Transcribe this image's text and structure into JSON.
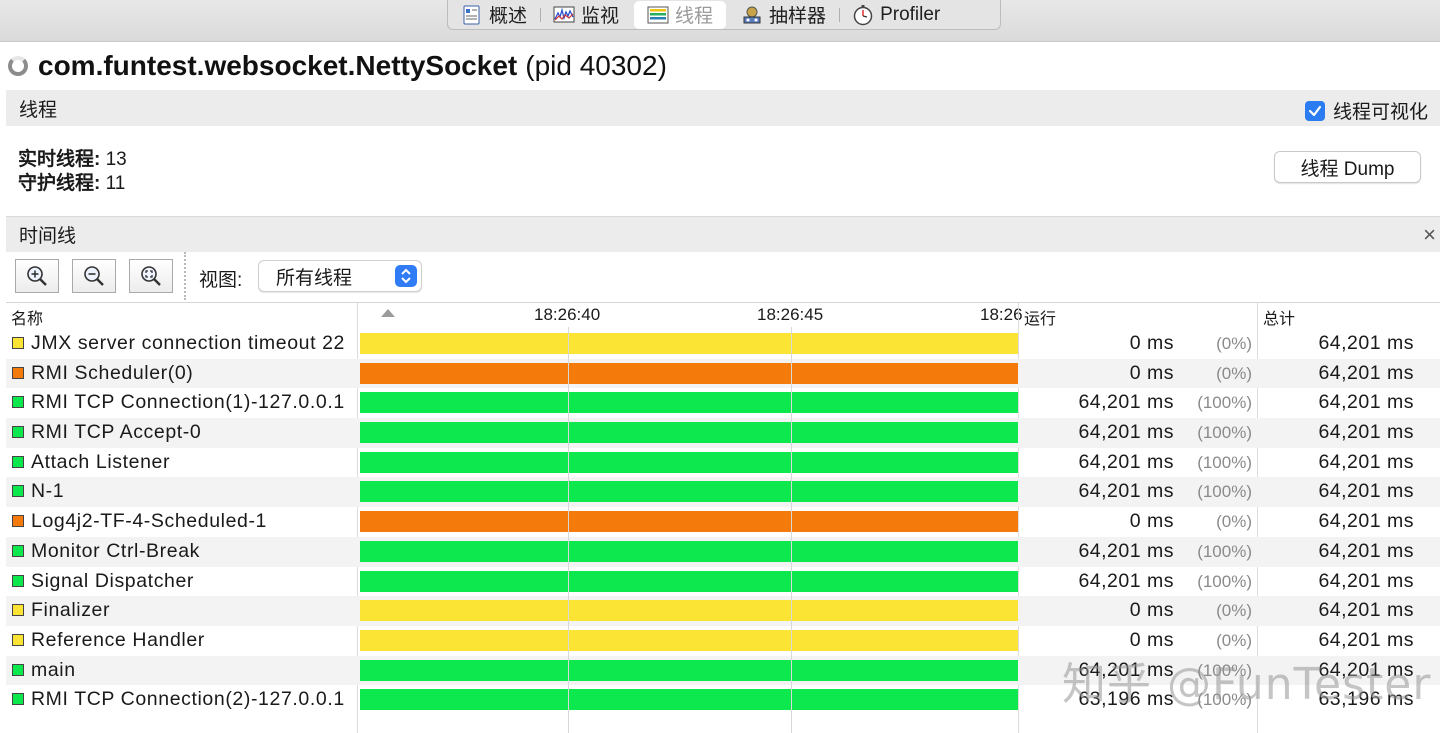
{
  "tabs": [
    {
      "label": "概述",
      "icon": "overview-icon"
    },
    {
      "label": "监视",
      "icon": "monitor-icon"
    },
    {
      "label": "线程",
      "icon": "threads-icon",
      "active": true
    },
    {
      "label": "抽样器",
      "icon": "sampler-icon"
    },
    {
      "label": "Profiler",
      "icon": "profiler-icon"
    }
  ],
  "header": {
    "app_name": "com.funtest.websocket.NettySocket",
    "pid_text": "(pid 40302)"
  },
  "threads_section": {
    "title": "线程",
    "visualize_label": "线程可视化",
    "visualize_checked": true
  },
  "stats": {
    "live_label": "实时线程:",
    "live_value": "13",
    "daemon_label": "守护线程:",
    "daemon_value": "11"
  },
  "dump_button": "线程 Dump",
  "timeline_section": {
    "title": "时间线",
    "close": "×"
  },
  "toolbar": {
    "view_label": "视图:",
    "view_value": "所有线程"
  },
  "table": {
    "col_name": "名称",
    "col_run": "运行",
    "col_total": "总计",
    "ticks": [
      "18:26:40",
      "18:26:45",
      "18:26"
    ],
    "rows": [
      {
        "name": "JMX server connection timeout 22",
        "state": "wait",
        "run": "0 ms",
        "pct": "(0%)",
        "total": "64,201 ms"
      },
      {
        "name": "RMI Scheduler(0)",
        "state": "park",
        "run": "0 ms",
        "pct": "(0%)",
        "total": "64,201 ms"
      },
      {
        "name": "RMI TCP Connection(1)-127.0.0.1",
        "state": "run",
        "run": "64,201 ms",
        "pct": "(100%)",
        "total": "64,201 ms"
      },
      {
        "name": "RMI TCP Accept-0",
        "state": "run",
        "run": "64,201 ms",
        "pct": "(100%)",
        "total": "64,201 ms"
      },
      {
        "name": "Attach Listener",
        "state": "run",
        "run": "64,201 ms",
        "pct": "(100%)",
        "total": "64,201 ms"
      },
      {
        "name": "N-1",
        "state": "run",
        "run": "64,201 ms",
        "pct": "(100%)",
        "total": "64,201 ms"
      },
      {
        "name": "Log4j2-TF-4-Scheduled-1",
        "state": "park",
        "run": "0 ms",
        "pct": "(0%)",
        "total": "64,201 ms"
      },
      {
        "name": "Monitor Ctrl-Break",
        "state": "run",
        "run": "64,201 ms",
        "pct": "(100%)",
        "total": "64,201 ms"
      },
      {
        "name": "Signal Dispatcher",
        "state": "run",
        "run": "64,201 ms",
        "pct": "(100%)",
        "total": "64,201 ms"
      },
      {
        "name": "Finalizer",
        "state": "wait",
        "run": "0 ms",
        "pct": "(0%)",
        "total": "64,201 ms"
      },
      {
        "name": "Reference Handler",
        "state": "wait",
        "run": "0 ms",
        "pct": "(0%)",
        "total": "64,201 ms"
      },
      {
        "name": "main",
        "state": "run",
        "run": "64,201 ms",
        "pct": "(100%)",
        "total": "64,201 ms"
      },
      {
        "name": "RMI TCP Connection(2)-127.0.0.1",
        "state": "run",
        "run": "63,196 ms",
        "pct": "(100%)",
        "total": "63,196 ms"
      }
    ]
  },
  "colors": {
    "run": "#0ce84e",
    "wait": "#fce434",
    "park": "#f47a0c",
    "accent": "#2b7cf0"
  },
  "watermark": "知乎 @FunTester"
}
